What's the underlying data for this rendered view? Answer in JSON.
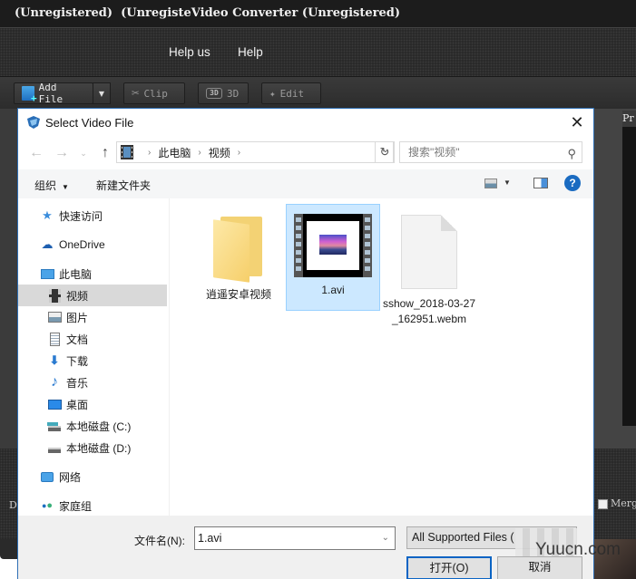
{
  "app": {
    "title": "(Unregistered)  (UnregisteVideo Converter (Unregistered)",
    "menu": [
      "Help us",
      "Help"
    ],
    "toolbar": {
      "add_file": "Add File",
      "clip": "Clip",
      "three_d": "3D",
      "edit": "Edit"
    },
    "preview_label": "Pr",
    "destination_label": "De",
    "merge_label": "Merge"
  },
  "dialog": {
    "title": "Select Video File",
    "close_glyph": "✕",
    "nav": {
      "back": "←",
      "forward": "→",
      "recent": "⌄",
      "up": "↑"
    },
    "breadcrumb": [
      "此电脑",
      "视频"
    ],
    "search_placeholder": "搜索\"视频\"",
    "commands": {
      "organize": "组织",
      "new_folder": "新建文件夹"
    },
    "help_glyph": "?",
    "tree": [
      {
        "label": "快速访问",
        "icon": "star-icon"
      },
      {
        "label": "OneDrive",
        "icon": "cloud-icon"
      },
      {
        "label": "此电脑",
        "icon": "computer-icon"
      },
      {
        "label": "视频",
        "icon": "video-folder-icon",
        "selected": true
      },
      {
        "label": "图片",
        "icon": "pictures-icon"
      },
      {
        "label": "文档",
        "icon": "documents-icon"
      },
      {
        "label": "下载",
        "icon": "download-icon"
      },
      {
        "label": "音乐",
        "icon": "music-icon"
      },
      {
        "label": "桌面",
        "icon": "desktop-icon"
      },
      {
        "label": "本地磁盘 (C:)",
        "icon": "drive-c-icon"
      },
      {
        "label": "本地磁盘 (D:)",
        "icon": "drive-d-icon"
      },
      {
        "label": "网络",
        "icon": "network-icon"
      },
      {
        "label": "家庭组",
        "icon": "homegroup-icon"
      }
    ],
    "files": [
      {
        "name": "逍遥安卓视频",
        "type": "folder"
      },
      {
        "name": "1.avi",
        "type": "video",
        "selected": true
      },
      {
        "name": "sshow_2018-03-27_162951.webm",
        "type": "file"
      }
    ],
    "filename_label": "文件名(N):",
    "filename_value": "1.avi",
    "filetype_value": "All Supported Files (",
    "open_button": "打开(O)",
    "cancel_button": "取消"
  },
  "watermark": "Yuucn.com"
}
